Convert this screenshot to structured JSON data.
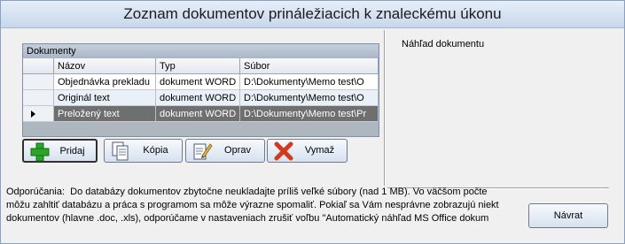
{
  "window": {
    "title": "Zoznam dokumentov prináležiacich k znaleckému úkonu"
  },
  "grid": {
    "caption": "Dokumenty",
    "columns": [
      "Názov",
      "Typ",
      "Súbor"
    ],
    "rows": [
      {
        "name": "Objednávka prekladu",
        "type": "dokument WORD",
        "file": "D:\\Dokumenty\\Memo test\\O"
      },
      {
        "name": "Originál text",
        "type": "dokument WORD",
        "file": "D:\\Dokumenty\\Memo test\\O"
      },
      {
        "name": "Preložený text",
        "type": "dokument WORD",
        "file": "D:\\Dokumenty\\Memo test\\Pr",
        "selected": true
      }
    ]
  },
  "buttons": {
    "add": {
      "label": "Pridaj",
      "icon": "plus-icon"
    },
    "copy": {
      "label": "Kópia",
      "icon": "copy-icon"
    },
    "edit": {
      "label": "Oprav",
      "icon": "edit-icon"
    },
    "delete": {
      "label": "Vymaž",
      "icon": "delete-x-icon"
    },
    "back": {
      "label": "Návrat"
    }
  },
  "preview": {
    "label": "Náhľad dokumentu"
  },
  "recommendations": {
    "heading": "Odporúčania:",
    "line1": "Do databázy dokumentov zbytočne neukladajte príliš veľké súbory (nad 1 MB).  Vo väčšom počte",
    "line2": "môžu zahltiť databázu a práca s programom sa môže výrazne spomaliť. Pokiaľ sa Vám nesprávne zobrazujú niekt",
    "line3": "dokumentov (hlavne .doc, .xls), odporúčame v nastaveniach zrušiť voľbu \"Automatický náhľad MS Office dokum"
  },
  "colors": {
    "selected_row": "#6f6f6f",
    "alt_row": "#e9f0f8",
    "add_icon": "#2aa52a",
    "delete_icon": "#d23a1e"
  }
}
